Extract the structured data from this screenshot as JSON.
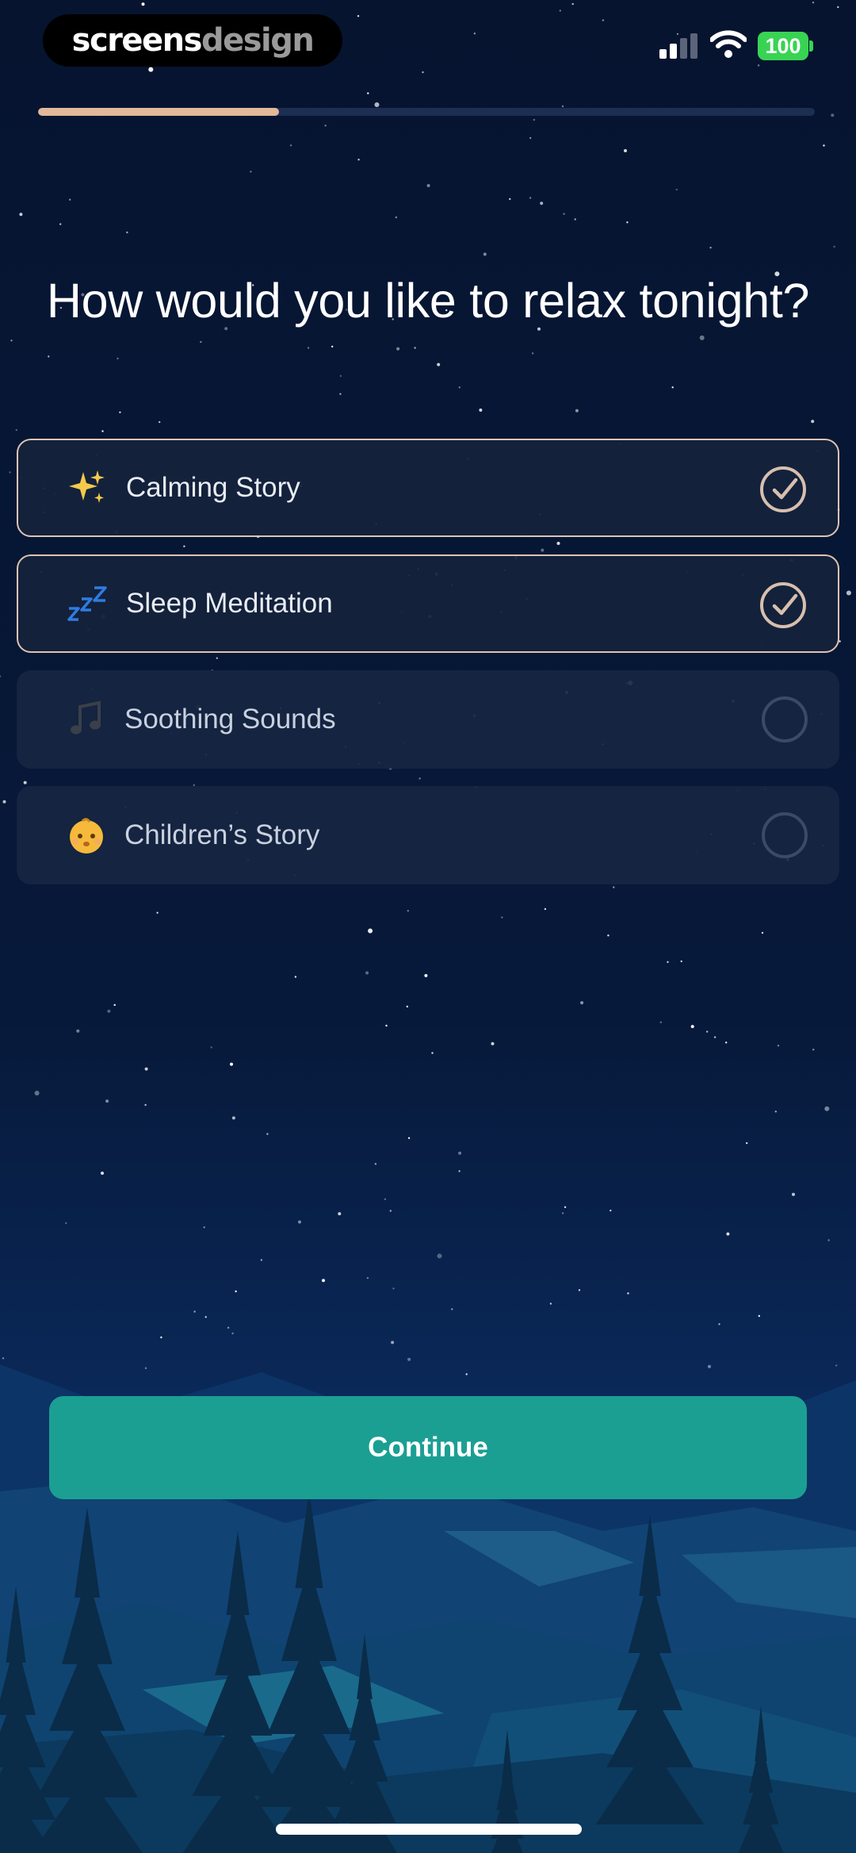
{
  "status_bar": {
    "brand_part1": "screens",
    "brand_part2": "design",
    "battery": "100",
    "signal_bars_active": 2,
    "signal_bars_total": 4
  },
  "progress": {
    "fraction": 0.31
  },
  "question": {
    "title": "How would you like to relax tonight?"
  },
  "options": [
    {
      "label": "Calming Story",
      "icon": "sparkles-icon",
      "selected": true
    },
    {
      "label": "Sleep Meditation",
      "icon": "zzz-icon",
      "selected": true
    },
    {
      "label": "Soothing Sounds",
      "icon": "music-note-icon",
      "selected": false
    },
    {
      "label": "Children’s Story",
      "icon": "baby-face-icon",
      "selected": false
    }
  ],
  "actions": {
    "continue_label": "Continue"
  },
  "colors": {
    "accent": "#1b9f93",
    "selected_border": "#ddc4b2",
    "progress": "#e2b999",
    "background": "#061530"
  }
}
